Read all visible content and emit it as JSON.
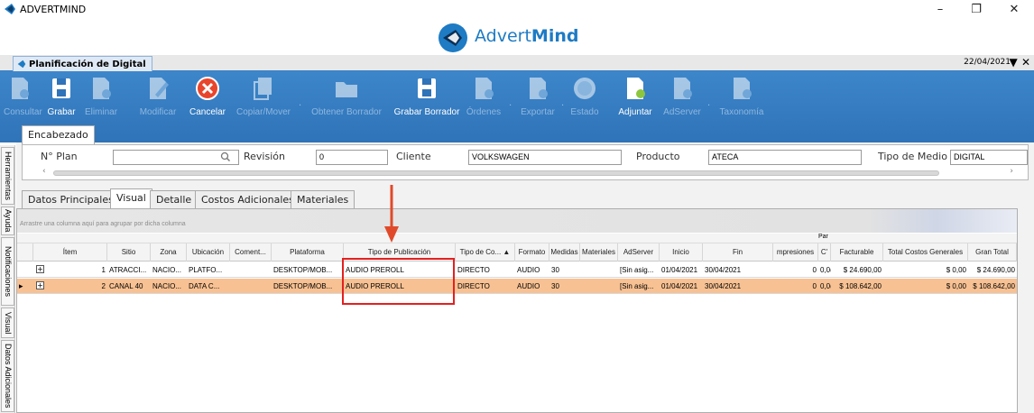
{
  "window": {
    "title": "ADVERTMIND",
    "minimize": "–",
    "restore": "❐",
    "close": "✕"
  },
  "logo": {
    "brand_light": "Advert",
    "brand_bold": "Mind",
    "color": "#1e7bc4"
  },
  "document": {
    "tab_label": "Planificación de Digital",
    "date": "22/04/2021",
    "menu_glyph": "▼",
    "close_glyph": "✕"
  },
  "toolbar": {
    "consultar": "Consultar",
    "grabar": "Grabar",
    "eliminar": "Eliminar",
    "modificar": "Modificar",
    "cancelar": "Cancelar",
    "copiar_mover": "Copiar/Mover",
    "obtener_borrador": "Obtener Borrador",
    "grabar_borrador": "Grabar Borrador",
    "ordenes": "Órdenes",
    "exportar": "Exportar",
    "estado": "Estado",
    "adjuntar": "Adjuntar",
    "adserver": "AdServer",
    "taxonomia": "Taxonomía",
    "sep": "."
  },
  "side_tabs": {
    "herramientas": "Herramientas",
    "ayuda": "Ayuda",
    "notificaciones": "Notificaciones",
    "visual": "Visual",
    "datos_adicionales": "Datos Adicionales"
  },
  "encabezado": {
    "tab": "Encabezado",
    "plan_label": "N° Plan",
    "plan_value": "",
    "revision_label": "Revisión",
    "revision_value": "0",
    "cliente_label": "Cliente",
    "cliente_value": "VOLKSWAGEN",
    "producto_label": "Producto",
    "producto_value": "ATECA",
    "tipo_medio_label": "Tipo de Medio",
    "tipo_medio_value": "DIGITAL"
  },
  "tabs": {
    "datos_principales": "Datos Principales",
    "visual": "Visual",
    "detalle": "Detalle",
    "costos_adicionales": "Costos Adicionales",
    "materiales": "Materiales"
  },
  "grid": {
    "group_hint": "Arrastre una columna aquí para agrupar por dicha columna",
    "top_header": "Par",
    "columns": {
      "item": "Ítem",
      "sitio": "Sitio",
      "zona": "Zona",
      "ubicacion": "Ubicación",
      "comentario": "Coment...",
      "plataforma": "Plataforma",
      "tipo_publicacion": "Tipo de Publicación",
      "tipo_compra": "Tipo de Co... ▲",
      "formato": "Formato",
      "medidas": "Medidas",
      "materiales": "Materiales",
      "adserver": "AdServer",
      "inicio": "Inicio",
      "fin": "Fin",
      "impresiones": "mpresiones",
      "ct": "C'",
      "facturable": "Facturable",
      "total_costos": "Total Costos Generales",
      "gran_total": "Gran Total"
    },
    "rows": [
      {
        "expand": "+",
        "indicator": "",
        "item": "1",
        "sitio": "ATRACCI...",
        "zona": "NACIO...",
        "ubicacion": "PLATFO...",
        "comentario": "",
        "plataforma": "DESKTOP/MOB...",
        "tipo_publicacion": "AUDIO PREROLL",
        "tipo_compra": "DIRECTO",
        "formato": "AUDIO",
        "medidas": "30",
        "materiales": "",
        "adserver": "[Sin asig...",
        "inicio": "01/04/2021",
        "fin": "30/04/2021",
        "impresiones": "0",
        "ct": "0,0(",
        "facturable": "$ 24.690,00",
        "total_costos": "$ 0,00",
        "gran_total": "$ 24.690,00"
      },
      {
        "expand": "+",
        "indicator": "▸",
        "item": "2",
        "sitio": "CANAL 40",
        "zona": "NACIO...",
        "ubicacion": "DATA C...",
        "comentario": "",
        "plataforma": "DESKTOP/MOB...",
        "tipo_publicacion": "AUDIO PREROLL",
        "tipo_compra": "DIRECTO",
        "formato": "AUDIO",
        "medidas": "30",
        "materiales": "",
        "adserver": "[Sin asig...",
        "inicio": "01/04/2021",
        "fin": "30/04/2021",
        "impresiones": "0",
        "ct": "0,0(",
        "facturable": "$ 108.642,00",
        "total_costos": "$ 0,00",
        "gran_total": "$ 108.642,00"
      }
    ]
  },
  "colors": {
    "ribbon": "#2f73b8",
    "selected_row": "#f7c193",
    "annotation": "#e32020"
  }
}
